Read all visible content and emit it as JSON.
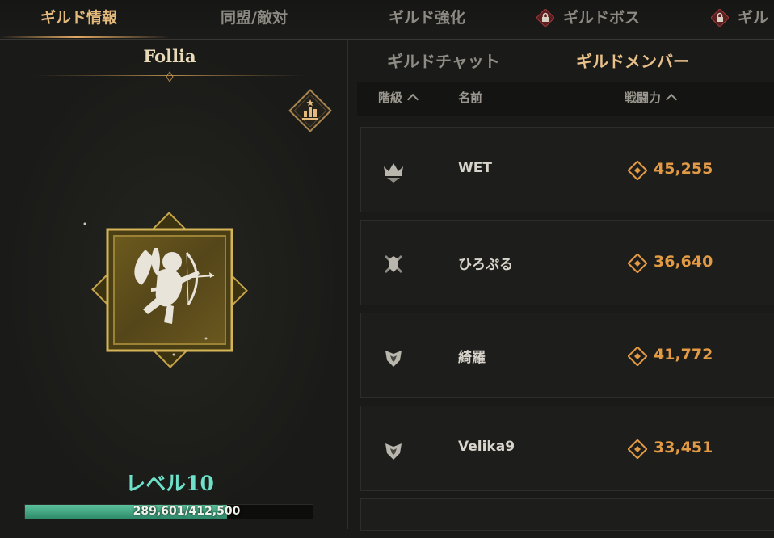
{
  "top_tabs": [
    {
      "label": "ギルド情報",
      "active": true,
      "locked": false
    },
    {
      "label": "同盟/敵対",
      "active": false,
      "locked": false
    },
    {
      "label": "ギルド強化",
      "active": false,
      "locked": false
    },
    {
      "label": "ギルドボス",
      "active": false,
      "locked": true
    },
    {
      "label": "ギル",
      "active": false,
      "locked": true
    }
  ],
  "guild": {
    "name": "Follia",
    "rank_badge_icon": "ranking-chart-icon",
    "emblem_icon": "cupid-archer-emblem",
    "level_label": "レベル10",
    "exp_text": "289,601/412,500",
    "exp_fraction": 0.702
  },
  "sub_tabs": [
    {
      "label": "ギルドチャット",
      "active": false
    },
    {
      "label": "ギルドメンバー",
      "active": true
    }
  ],
  "columns": {
    "rank": "階級",
    "name": "名前",
    "power": "戦闘力"
  },
  "members": [
    {
      "rank_icon": "guild-master-crown-icon",
      "name": "WET",
      "power": "45,255"
    },
    {
      "rank_icon": "guild-officer-icon",
      "name": "ひろぷる",
      "power": "36,640"
    },
    {
      "rank_icon": "guild-member-icon",
      "name": "綺羅",
      "power": "41,772"
    },
    {
      "rank_icon": "guild-member-icon",
      "name": "Velika9",
      "power": "33,451"
    }
  ],
  "colors": {
    "accent_gold": "#e3b97c",
    "level_teal": "#6fe0c9",
    "exp_green": "#5bc29c",
    "power_orange": "#e39a45"
  }
}
